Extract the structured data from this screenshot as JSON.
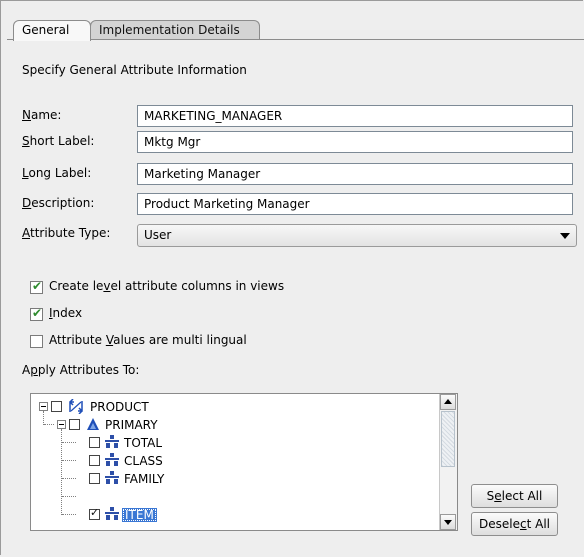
{
  "tabs": [
    {
      "label": "General",
      "active": true
    },
    {
      "label": "Implementation Details",
      "active": false
    }
  ],
  "section_heading": "Specify General Attribute Information",
  "form": {
    "name": {
      "label_u": "N",
      "label_rest": "ame:",
      "value": "MARKETING_MANAGER"
    },
    "short_label": {
      "label_u": "S",
      "label_rest": "hort Label:",
      "value": "Mktg Mgr"
    },
    "long_label": {
      "label_u": "L",
      "label_rest": "ong Label:",
      "value": "Marketing Manager"
    },
    "description": {
      "label_u": "D",
      "label_rest": "escription:",
      "value": "Product Marketing Manager"
    },
    "attribute_type": {
      "label_u": "A",
      "label_rest": "ttribute Type:",
      "value": "User"
    }
  },
  "options": {
    "create_level": {
      "pre": "Create le",
      "u": "v",
      "post": "el attribute columns in views",
      "checked": true
    },
    "index": {
      "pre": "",
      "u": "I",
      "post": "ndex",
      "checked": true
    },
    "multilingual": {
      "pre": "Attribute ",
      "u": "V",
      "post": "alues are multi lingual",
      "checked": false
    }
  },
  "apply_label": {
    "pre": "A",
    "u": "p",
    "post": "ply Attributes To:"
  },
  "tree": {
    "dimension": {
      "label": "PRODUCT",
      "icon": "dimension-icon",
      "checked": false
    },
    "hierarchy": {
      "label": "PRIMARY",
      "icon": "hierarchy-icon",
      "checked": false
    },
    "levels": [
      {
        "label": "TOTAL",
        "checked": false,
        "selected": false
      },
      {
        "label": "CLASS",
        "checked": false,
        "selected": false
      },
      {
        "label": "FAMILY",
        "checked": false,
        "selected": false
      },
      {
        "label": "ITEM",
        "checked": true,
        "selected": true
      }
    ]
  },
  "buttons": {
    "select_all": {
      "pre": "S",
      "u": "e",
      "post": "lect All"
    },
    "deselect_all": {
      "pre": "Desele",
      "u": "c",
      "post": "t All"
    }
  },
  "colors": {
    "check_green": "#2e8b2e",
    "selection_blue": "#3a77d4",
    "level_icon": "#2d4fa8",
    "hierarchy_icon": "#1f4fb8"
  }
}
